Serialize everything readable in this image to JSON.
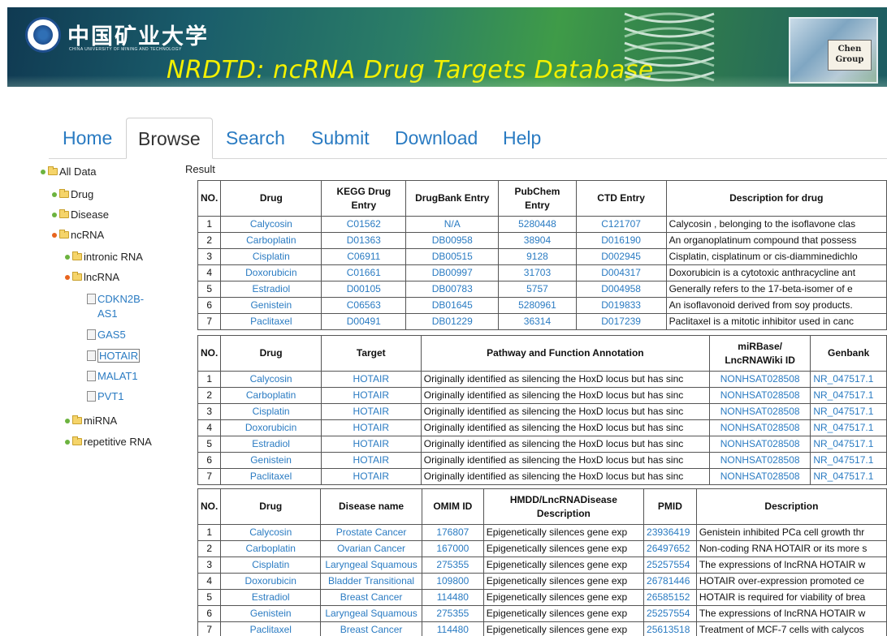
{
  "banner": {
    "univ_cn": "中国矿业大学",
    "univ_en": "CHINA UNIVERSITY OF MINING AND TECHNOLOGY",
    "title": "NRDTD: ncRNA Drug Targets Database",
    "group_label": "Chen\nGroup",
    "colors": {
      "title": "#f3f000",
      "banner_start": "#103a52",
      "banner_mid": "#3f9b48"
    },
    "icons": [
      "university-emblem-icon",
      "dna-helix-icon",
      "chen-group-logo"
    ]
  },
  "nav": {
    "tabs": [
      {
        "label": "Home",
        "active": false
      },
      {
        "label": "Browse",
        "active": true
      },
      {
        "label": "Search",
        "active": false
      },
      {
        "label": "Submit",
        "active": false
      },
      {
        "label": "Download",
        "active": false
      },
      {
        "label": "Help",
        "active": false
      }
    ]
  },
  "tree": {
    "all_data": "All Data",
    "drug": "Drug",
    "disease": "Disease",
    "ncrna": "ncRNA",
    "intronic": "intronic RNA",
    "lncrna": "lncRNA",
    "leaves": [
      "CDKN2B-AS1",
      "GAS5",
      "HOTAIR",
      "MALAT1",
      "PVT1"
    ],
    "selected": "HOTAIR",
    "mirna": "miRNA",
    "repetitive": "repetitive RNA",
    "colors": {
      "dot_expanded": "#e8641e",
      "dot_collapsed": "#6cb33f",
      "link": "#2a7bc2"
    }
  },
  "result_label": "Result",
  "table1": {
    "headers": [
      "NO.",
      "Drug",
      "KEGG Drug Entry",
      "DrugBank Entry",
      "PubChem Entry",
      "CTD Entry",
      "Description for drug"
    ],
    "rows": [
      [
        "1",
        "Calycosin",
        "C01562",
        "N/A",
        "5280448",
        "C121707",
        "Calycosin , belonging to the isoflavone clas"
      ],
      [
        "2",
        "Carboplatin",
        "D01363",
        "DB00958",
        "38904",
        "D016190",
        "An organoplatinum compound that possess"
      ],
      [
        "3",
        "Cisplatin",
        "C06911",
        "DB00515",
        "9128",
        "D002945",
        "Cisplatin, cisplatinum or cis-diamminedichlo"
      ],
      [
        "4",
        "Doxorubicin",
        "C01661",
        "DB00997",
        "31703",
        "D004317",
        "Doxorubicin is a cytotoxic anthracycline ant"
      ],
      [
        "5",
        "Estradiol",
        "D00105",
        "DB00783",
        "5757",
        "D004958",
        "Generally refers to the 17-beta-isomer of e"
      ],
      [
        "6",
        "Genistein",
        "C06563",
        "DB01645",
        "5280961",
        "D019833",
        "An isoflavonoid derived from soy products."
      ],
      [
        "7",
        "Paclitaxel",
        "D00491",
        "DB01229",
        "36314",
        "D017239",
        "Paclitaxel is a mitotic inhibitor used in canc"
      ]
    ]
  },
  "table2": {
    "headers": [
      "NO.",
      "Drug",
      "Target",
      "Pathway and Function Annotation",
      "miRBase/ LncRNAWiki ID",
      "Genbank"
    ],
    "rows": [
      [
        "1",
        "Calycosin",
        "HOTAIR",
        "Originally identified as silencing the HoxD locus but has sinc",
        "NONHSAT028508",
        "NR_047517.1"
      ],
      [
        "2",
        "Carboplatin",
        "HOTAIR",
        "Originally identified as silencing the HoxD locus but has sinc",
        "NONHSAT028508",
        "NR_047517.1"
      ],
      [
        "3",
        "Cisplatin",
        "HOTAIR",
        "Originally identified as silencing the HoxD locus but has sinc",
        "NONHSAT028508",
        "NR_047517.1"
      ],
      [
        "4",
        "Doxorubicin",
        "HOTAIR",
        "Originally identified as silencing the HoxD locus but has sinc",
        "NONHSAT028508",
        "NR_047517.1"
      ],
      [
        "5",
        "Estradiol",
        "HOTAIR",
        "Originally identified as silencing the HoxD locus but has sinc",
        "NONHSAT028508",
        "NR_047517.1"
      ],
      [
        "6",
        "Genistein",
        "HOTAIR",
        "Originally identified as silencing the HoxD locus but has sinc",
        "NONHSAT028508",
        "NR_047517.1"
      ],
      [
        "7",
        "Paclitaxel",
        "HOTAIR",
        "Originally identified as silencing the HoxD locus but has sinc",
        "NONHSAT028508",
        "NR_047517.1"
      ]
    ]
  },
  "table3": {
    "headers": [
      "NO.",
      "Drug",
      "Disease name",
      "OMIM ID",
      "HMDD/LncRNADisease Description",
      "PMID",
      "Description"
    ],
    "rows": [
      [
        "1",
        "Calycosin",
        "Prostate Cancer",
        "176807",
        "Epigenetically silences gene exp",
        "23936419",
        "Genistein inhibited PCa cell growth thr"
      ],
      [
        "2",
        "Carboplatin",
        "Ovarian Cancer",
        "167000",
        "Epigenetically silences gene exp",
        "26497652",
        "Non-coding RNA HOTAIR or its more s"
      ],
      [
        "3",
        "Cisplatin",
        "Laryngeal Squamous",
        "275355",
        "Epigenetically silences gene exp",
        "25257554",
        "The expressions of lncRNA HOTAIR w"
      ],
      [
        "4",
        "Doxorubicin",
        "Bladder Transitional",
        "109800",
        "Epigenetically silences gene exp",
        "26781446",
        "HOTAIR over-expression promoted ce"
      ],
      [
        "5",
        "Estradiol",
        "Breast Cancer",
        "114480",
        "Epigenetically silences gene exp",
        "26585152",
        "HOTAIR is required for viability of brea"
      ],
      [
        "6",
        "Genistein",
        "Laryngeal Squamous",
        "275355",
        "Epigenetically silences gene exp",
        "25257554",
        "The expressions of lncRNA HOTAIR w"
      ],
      [
        "7",
        "Paclitaxel",
        "Breast Cancer",
        "114480",
        "Epigenetically silences gene exp",
        "25613518",
        "Treatment of MCF-7 cells with calycos"
      ]
    ]
  }
}
